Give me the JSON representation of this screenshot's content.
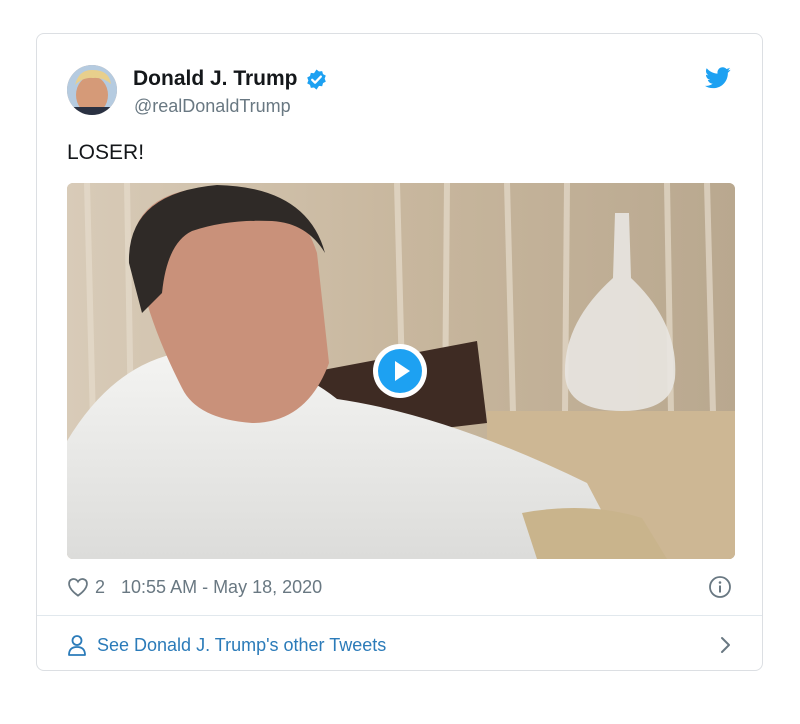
{
  "tweet": {
    "author": {
      "display_name": "Donald J. Trump",
      "handle": "@realDonaldTrump",
      "verified": true
    },
    "text": "LOSER!",
    "media": {
      "type": "video"
    },
    "like_count": "2",
    "timestamp": "10:55 AM - May 18, 2020"
  },
  "footer": {
    "other_tweets_label": "See Donald J. Trump's other Tweets"
  },
  "icons": {
    "brand": "twitter-bird-icon",
    "verified": "verified-badge-icon",
    "like": "heart-icon",
    "info": "info-icon",
    "person": "person-icon",
    "chevron": "chevron-right-icon",
    "play": "play-icon"
  },
  "colors": {
    "brand_blue": "#1da1f2",
    "link_blue": "#2b7bb9",
    "text": "#14171a",
    "muted": "#697882",
    "border": "#dcdfe3"
  }
}
